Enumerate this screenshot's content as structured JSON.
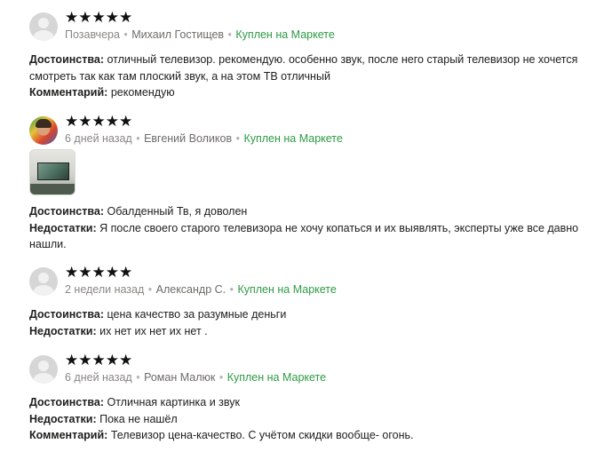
{
  "reviews": [
    {
      "stars": "★★★★★",
      "date": "Позавчера",
      "author": "Михаил Гостищев",
      "bought": "Куплен на Маркете",
      "avatar": "default-user-icon",
      "lines": [
        {
          "label": "Достоинства:",
          "text": " отличный телевизор. рекомендую. особенно звук, после него старый телевизор не хочется смотреть так как там плоский звук, а на этом ТВ отличный"
        },
        {
          "label": "Комментарий:",
          "text": " рекомендую"
        }
      ]
    },
    {
      "stars": "★★★★★",
      "date": "6 дней назад",
      "author": "Евгений Воликов",
      "bought": "Куплен на Маркете",
      "avatar": "user-photo",
      "has_photo": true,
      "lines": [
        {
          "label": "Достоинства:",
          "text": " Обалденный Тв, я доволен"
        },
        {
          "label": "Недостатки:",
          "text": " Я после своего старого телевизора не хочу копаться и их выявлять, эксперты уже все давно нашли."
        }
      ]
    },
    {
      "stars": "★★★★★",
      "date": "2 недели назад",
      "author": "Александр С.",
      "bought": "Куплен на Маркете",
      "avatar": "default-user-icon",
      "lines": [
        {
          "label": "Достоинства:",
          "text": " цена качество за разумные деньги"
        },
        {
          "label": "Недостатки:",
          "text": " их нет их нет их нет ."
        }
      ]
    },
    {
      "stars": "★★★★★",
      "date": "6 дней назад",
      "author": "Роман Малюк",
      "bought": "Куплен на Маркете",
      "avatar": "default-user-icon",
      "lines": [
        {
          "label": "Достоинства:",
          "text": " Отличная картинка и звук"
        },
        {
          "label": "Недостатки:",
          "text": " Пока не нашёл"
        },
        {
          "label": "Комментарий:",
          "text": " Телевизор цена-качество. С учётом скидки вообще- огонь."
        }
      ]
    }
  ]
}
